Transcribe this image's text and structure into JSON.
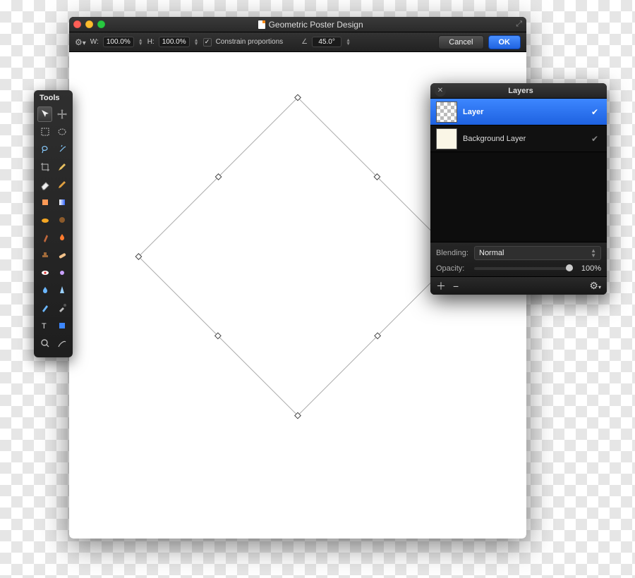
{
  "window": {
    "title": "Geometric Poster Design"
  },
  "toolbar": {
    "width_label": "W:",
    "width_value": "100.0%",
    "height_label": "H:",
    "height_value": "100.0%",
    "constrain_label": "Constrain proportions",
    "angle_value": "45.0°",
    "cancel_label": "Cancel",
    "ok_label": "OK"
  },
  "tools_panel": {
    "title": "Tools"
  },
  "layers_panel": {
    "title": "Layers",
    "rows": [
      {
        "name": "Layer",
        "selected": true,
        "visible": true,
        "thumb": "checker"
      },
      {
        "name": "Background Layer",
        "selected": false,
        "visible": true,
        "thumb": "solid"
      }
    ],
    "blending_label": "Blending:",
    "blending_value": "Normal",
    "opacity_label": "Opacity:",
    "opacity_value": "100%"
  }
}
